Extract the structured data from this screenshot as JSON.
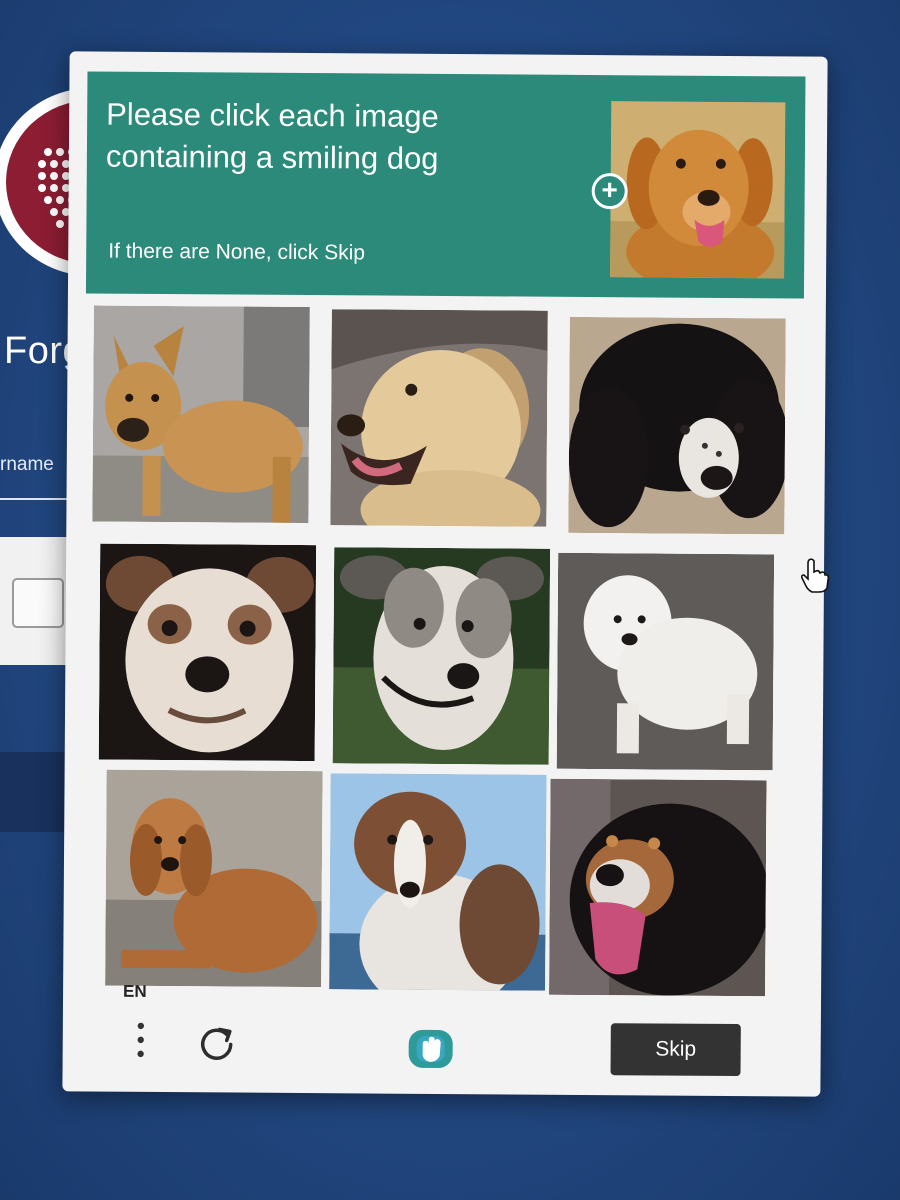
{
  "background": {
    "heading": "Forg",
    "field_label": "rname"
  },
  "captcha": {
    "prompt": "Please click each image containing a smiling dog",
    "hint": "If there are None, click Skip",
    "language": "EN",
    "skip_label": "Skip",
    "accent_color": "#2b8a79",
    "tiles": [
      {
        "subject": "tan dog standing"
      },
      {
        "subject": "golden retriever, mouth open"
      },
      {
        "subject": "black and white long-haired dog"
      },
      {
        "subject": "white boxer mix dog"
      },
      {
        "subject": "white and grey dog with collar"
      },
      {
        "subject": "small white fluffy dog"
      },
      {
        "subject": "golden retriever lying down"
      },
      {
        "subject": "brown and white shepherd dog"
      },
      {
        "subject": "tricolor dog, tongue out"
      }
    ]
  },
  "icons": [
    "plus-icon",
    "more-vertical-icon",
    "refresh-icon",
    "hcaptcha-logo-icon",
    "hand-pointer-icon"
  ]
}
